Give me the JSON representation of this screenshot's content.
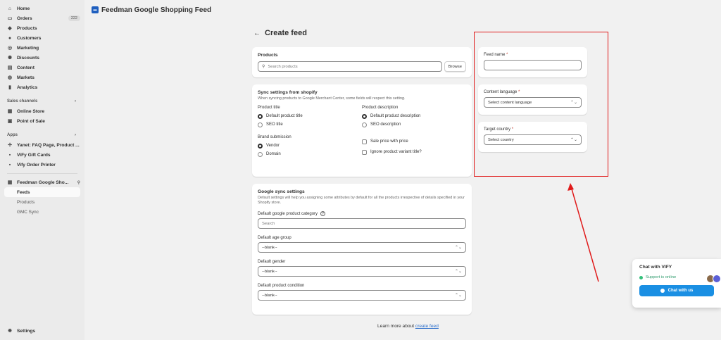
{
  "sidebar": {
    "main": [
      {
        "label": "Home",
        "icon": "home-icon",
        "glyph": "⌂"
      },
      {
        "label": "Orders",
        "icon": "orders-icon",
        "glyph": "▭",
        "badge": "222"
      },
      {
        "label": "Products",
        "icon": "tag-icon",
        "glyph": "◆"
      },
      {
        "label": "Customers",
        "icon": "person-icon",
        "glyph": "●"
      },
      {
        "label": "Marketing",
        "icon": "target-icon",
        "glyph": "◎"
      },
      {
        "label": "Discounts",
        "icon": "discount-icon",
        "glyph": "✺"
      },
      {
        "label": "Content",
        "icon": "content-icon",
        "glyph": "▤"
      },
      {
        "label": "Markets",
        "icon": "globe-icon",
        "glyph": "◍"
      },
      {
        "label": "Analytics",
        "icon": "chart-icon",
        "glyph": "▮"
      }
    ],
    "sales_channels_heading": "Sales channels",
    "sales_channels": [
      {
        "label": "Online Store",
        "icon": "store-icon",
        "glyph": "▦"
      },
      {
        "label": "Point of Sale",
        "icon": "pos-icon",
        "glyph": "▣"
      }
    ],
    "apps_heading": "Apps",
    "apps": [
      {
        "label": "Yanet: FAQ Page, Product ...",
        "icon": "app-pin-icon",
        "glyph": "✢"
      },
      {
        "label": "ViFy Gift Cards",
        "icon": "app-icon",
        "glyph": "▪"
      },
      {
        "label": "Vify Order Printer",
        "icon": "app-icon",
        "glyph": "▪"
      }
    ],
    "current_app": "Feedman Google Sho...",
    "current_app_sub": [
      {
        "label": "Feeds",
        "active": true
      },
      {
        "label": "Products",
        "active": false
      },
      {
        "label": "GMC Sync",
        "active": false
      }
    ],
    "settings": "Settings"
  },
  "header": {
    "app_title": "Feedman Google Shopping Feed"
  },
  "page": {
    "back_glyph": "←",
    "title": "Create feed"
  },
  "products_card": {
    "title": "Products",
    "search_placeholder": "Search products",
    "browse_label": "Browse"
  },
  "sync_card": {
    "title": "Sync settings from shopify",
    "subtitle": "When syncing products to Google Merchant Center, some fields will respect this setting.",
    "product_title_label": "Product title",
    "product_title_options": [
      {
        "label": "Default product title",
        "checked": true
      },
      {
        "label": "SEO title",
        "checked": false
      }
    ],
    "product_description_label": "Product description",
    "product_description_options": [
      {
        "label": "Default product description",
        "checked": true
      },
      {
        "label": "SEO description",
        "checked": false
      }
    ],
    "brand_label": "Brand submission",
    "brand_options": [
      {
        "label": "Vendor",
        "checked": true
      },
      {
        "label": "Domain",
        "checked": false
      }
    ],
    "checkboxes": [
      {
        "label": "Sale price with price",
        "checked": false
      },
      {
        "label": "Ignore product variant title?",
        "checked": false
      }
    ]
  },
  "google_card": {
    "title": "Google sync settings",
    "subtitle": "Default settings will help you assigning some attributes by default for all the products irrespective of details specified in your Shopify store.",
    "category_label": "Default google product category",
    "category_placeholder": "Search",
    "age_label": "Default age group",
    "age_value": "--blank--",
    "gender_label": "Default gender",
    "gender_value": "--blank--",
    "condition_label": "Default product condition",
    "condition_value": "--blank--"
  },
  "feed_name_card": {
    "label": "Feed name",
    "required": "*",
    "value": ""
  },
  "language_card": {
    "label": "Content language",
    "required": "*",
    "value": "Select content language"
  },
  "country_card": {
    "label": "Target country",
    "required": "*",
    "value": "Select country"
  },
  "footer": {
    "learn_prefix": "Learn more about ",
    "learn_link": "create feed"
  },
  "chat": {
    "title": "Chat with VIFY",
    "status": "Support is online",
    "button": "Chat with us"
  },
  "colors": {
    "annotation_red": "#e01b1b",
    "chat_blue": "#1a8fe3",
    "link_blue": "#2c6ecb"
  }
}
